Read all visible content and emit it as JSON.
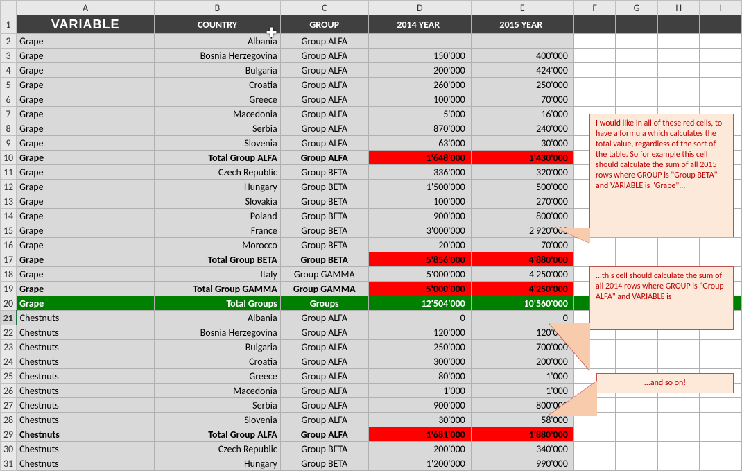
{
  "columns": [
    "A",
    "B",
    "C",
    "D",
    "E",
    "F",
    "G",
    "H",
    "I"
  ],
  "headers": {
    "A": "VARIABLE",
    "B": "COUNTRY",
    "C": "GROUP",
    "D": "2014 YEAR",
    "E": "2015 YEAR"
  },
  "rows": [
    {
      "n": 1,
      "type": "hdr"
    },
    {
      "n": 2,
      "A": "Grape",
      "B": "Albania",
      "C": "Group ALFA",
      "D": "",
      "E": ""
    },
    {
      "n": 3,
      "A": "Grape",
      "B": "Bosnia Herzegovina",
      "C": "Group ALFA",
      "D": "150'000",
      "E": "400'000"
    },
    {
      "n": 4,
      "A": "Grape",
      "B": "Bulgaria",
      "C": "Group ALFA",
      "D": "200'000",
      "E": "424'000"
    },
    {
      "n": 5,
      "A": "Grape",
      "B": "Croatia",
      "C": "Group ALFA",
      "D": "260'000",
      "E": "250'000"
    },
    {
      "n": 6,
      "A": "Grape",
      "B": "Greece",
      "C": "Group ALFA",
      "D": "100'000",
      "E": "70'000"
    },
    {
      "n": 7,
      "A": "Grape",
      "B": "Macedonia",
      "C": "Group ALFA",
      "D": "5'000",
      "E": "16'000"
    },
    {
      "n": 8,
      "A": "Grape",
      "B": "Serbia",
      "C": "Group ALFA",
      "D": "870'000",
      "E": "240'000"
    },
    {
      "n": 9,
      "A": "Grape",
      "B": "Slovenia",
      "C": "Group ALFA",
      "D": "63'000",
      "E": "30'000"
    },
    {
      "n": 10,
      "type": "subtot",
      "A": "Grape",
      "B": "Total Group ALFA",
      "C": "Group ALFA",
      "D": "1'648'000",
      "E": "1'430'000"
    },
    {
      "n": 11,
      "A": "Grape",
      "B": "Czech Republic",
      "C": "Group BETA",
      "D": "336'000",
      "E": "320'000"
    },
    {
      "n": 12,
      "A": "Grape",
      "B": "Hungary",
      "C": "Group BETA",
      "D": "1'500'000",
      "E": "500'000"
    },
    {
      "n": 13,
      "A": "Grape",
      "B": "Slovakia",
      "C": "Group BETA",
      "D": "100'000",
      "E": "270'000"
    },
    {
      "n": 14,
      "A": "Grape",
      "B": "Poland",
      "C": "Group BETA",
      "D": "900'000",
      "E": "800'000"
    },
    {
      "n": 15,
      "A": "Grape",
      "B": "France",
      "C": "Group BETA",
      "D": "3'000'000",
      "E": "2'920'000"
    },
    {
      "n": 16,
      "A": "Grape",
      "B": "Morocco",
      "C": "Group BETA",
      "D": "20'000",
      "E": "70'000"
    },
    {
      "n": 17,
      "type": "subtot",
      "A": "Grape",
      "B": "Total Group BETA",
      "C": "Group BETA",
      "D": "5'856'000",
      "E": "4'880'000"
    },
    {
      "n": 18,
      "A": "Grape",
      "B": "Italy",
      "C": "Group GAMMA",
      "D": "5'000'000",
      "E": "4'250'000"
    },
    {
      "n": 19,
      "type": "subtot",
      "A": "Grape",
      "B": "Total Group GAMMA",
      "C": "Group GAMMA",
      "D": "5'000'000",
      "E": "4'250'000"
    },
    {
      "n": 20,
      "type": "tot",
      "A": "Grape",
      "B": "Total Groups",
      "C": "Groups",
      "D": "12'504'000",
      "E": "10'560'000"
    },
    {
      "n": 21,
      "sel": true,
      "A": "Chestnuts",
      "B": "Albania",
      "C": "Group ALFA",
      "D": "0",
      "E": "0"
    },
    {
      "n": 22,
      "A": "Chestnuts",
      "B": "Bosnia Herzegovina",
      "C": "Group ALFA",
      "D": "120'000",
      "E": "120'000"
    },
    {
      "n": 23,
      "A": "Chestnuts",
      "B": "Bulgaria",
      "C": "Group ALFA",
      "D": "250'000",
      "E": "700'000"
    },
    {
      "n": 24,
      "A": "Chestnuts",
      "B": "Croatia",
      "C": "Group ALFA",
      "D": "300'000",
      "E": "200'000"
    },
    {
      "n": 25,
      "A": "Chestnuts",
      "B": "Greece",
      "C": "Group ALFA",
      "D": "80'000",
      "E": "1'000"
    },
    {
      "n": 26,
      "A": "Chestnuts",
      "B": "Macedonia",
      "C": "Group ALFA",
      "D": "1'000",
      "E": "1'000"
    },
    {
      "n": 27,
      "A": "Chestnuts",
      "B": "Serbia",
      "C": "Group ALFA",
      "D": "900'000",
      "E": "800'000"
    },
    {
      "n": 28,
      "A": "Chestnuts",
      "B": "Slovenia",
      "C": "Group ALFA",
      "D": "30'000",
      "E": "58'000"
    },
    {
      "n": 29,
      "type": "subtot",
      "A": "Chestnuts",
      "B": "Total Group ALFA",
      "C": "Group ALFA",
      "D": "1'681'000",
      "E": "1'880'000"
    },
    {
      "n": 30,
      "A": "Chestnuts",
      "B": "Czech Republic",
      "C": "Group BETA",
      "D": "200'000",
      "E": "340'000"
    },
    {
      "n": 31,
      "A": "Chestnuts",
      "B": "Hungary",
      "C": "Group BETA",
      "D": "1'200'000",
      "E": "990'000"
    }
  ],
  "callouts": {
    "c1": "I would like in all of these red cells, to have a formula which calculates the total value, regardless of the sort of the table. So for example this cell should calculate the sum of all 2015 rows where GROUP is \"Group BETA\" and VARIABLE is \"Grape\"...",
    "c2": "...this cell should calculate the sum of all 2014 rows where GROUP is \"Group ALFA\" and VARIABLE is",
    "c3": "...and so on!"
  },
  "chart_data": {
    "type": "table",
    "title": "",
    "columns": [
      "VARIABLE",
      "COUNTRY",
      "GROUP",
      "2014 YEAR",
      "2015 YEAR"
    ],
    "data": [
      [
        "Grape",
        "Albania",
        "Group ALFA",
        null,
        null
      ],
      [
        "Grape",
        "Bosnia Herzegovina",
        "Group ALFA",
        150000,
        400000
      ],
      [
        "Grape",
        "Bulgaria",
        "Group ALFA",
        200000,
        424000
      ],
      [
        "Grape",
        "Croatia",
        "Group ALFA",
        260000,
        250000
      ],
      [
        "Grape",
        "Greece",
        "Group ALFA",
        100000,
        70000
      ],
      [
        "Grape",
        "Macedonia",
        "Group ALFA",
        5000,
        16000
      ],
      [
        "Grape",
        "Serbia",
        "Group ALFA",
        870000,
        240000
      ],
      [
        "Grape",
        "Slovenia",
        "Group ALFA",
        63000,
        30000
      ],
      [
        "Grape",
        "Total Group ALFA",
        "Group ALFA",
        1648000,
        1430000
      ],
      [
        "Grape",
        "Czech Republic",
        "Group BETA",
        336000,
        320000
      ],
      [
        "Grape",
        "Hungary",
        "Group BETA",
        1500000,
        500000
      ],
      [
        "Grape",
        "Slovakia",
        "Group BETA",
        100000,
        270000
      ],
      [
        "Grape",
        "Poland",
        "Group BETA",
        900000,
        800000
      ],
      [
        "Grape",
        "France",
        "Group BETA",
        3000000,
        2920000
      ],
      [
        "Grape",
        "Morocco",
        "Group BETA",
        20000,
        70000
      ],
      [
        "Grape",
        "Total Group BETA",
        "Group BETA",
        5856000,
        4880000
      ],
      [
        "Grape",
        "Italy",
        "Group GAMMA",
        5000000,
        4250000
      ],
      [
        "Grape",
        "Total Group GAMMA",
        "Group GAMMA",
        5000000,
        4250000
      ],
      [
        "Grape",
        "Total Groups",
        "Groups",
        12504000,
        10560000
      ],
      [
        "Chestnuts",
        "Albania",
        "Group ALFA",
        0,
        0
      ],
      [
        "Chestnuts",
        "Bosnia Herzegovina",
        "Group ALFA",
        120000,
        120000
      ],
      [
        "Chestnuts",
        "Bulgaria",
        "Group ALFA",
        250000,
        700000
      ],
      [
        "Chestnuts",
        "Croatia",
        "Group ALFA",
        300000,
        200000
      ],
      [
        "Chestnuts",
        "Greece",
        "Group ALFA",
        80000,
        1000
      ],
      [
        "Chestnuts",
        "Macedonia",
        "Group ALFA",
        1000,
        1000
      ],
      [
        "Chestnuts",
        "Serbia",
        "Group ALFA",
        900000,
        800000
      ],
      [
        "Chestnuts",
        "Slovenia",
        "Group ALFA",
        30000,
        58000
      ],
      [
        "Chestnuts",
        "Total Group ALFA",
        "Group ALFA",
        1681000,
        1880000
      ],
      [
        "Chestnuts",
        "Czech Republic",
        "Group BETA",
        200000,
        340000
      ],
      [
        "Chestnuts",
        "Hungary",
        "Group BETA",
        1200000,
        990000
      ]
    ]
  }
}
